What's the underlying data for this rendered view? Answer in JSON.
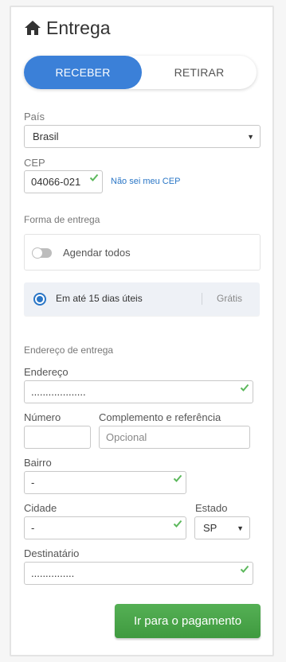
{
  "header": {
    "title": "Entrega",
    "icon": "home-icon"
  },
  "delivery_mode": {
    "options": [
      "RECEBER",
      "RETIRAR"
    ],
    "selected": "RECEBER",
    "accent": "#3b80d8"
  },
  "country": {
    "label": "País",
    "value": "Brasil"
  },
  "cep": {
    "label": "CEP",
    "value": "04066-021",
    "help_link": "Não sei meu CEP"
  },
  "delivery_form": {
    "label": "Forma de entrega",
    "schedule_all": {
      "label": "Agendar todos",
      "enabled": false
    },
    "option": {
      "text": "Em até 15 dias úteis",
      "price": "Grátis",
      "selected": true
    }
  },
  "address": {
    "section_label": "Endereço de entrega",
    "street": {
      "label": "Endereço",
      "value": "..................."
    },
    "number": {
      "label": "Número",
      "value": ""
    },
    "complement": {
      "label": "Complemento e referência",
      "placeholder": "Opcional"
    },
    "neighborhood": {
      "label": "Bairro",
      "value": "-"
    },
    "city": {
      "label": "Cidade",
      "value": "-"
    },
    "state": {
      "label": "Estado",
      "value": "SP"
    },
    "recipient": {
      "label": "Destinatário",
      "value": "..............."
    }
  },
  "actions": {
    "submit": "Ir para o pagamento",
    "submit_color": "#4aa44a"
  },
  "colors": {
    "valid_check": "#5cb85c",
    "link": "#2a76c6"
  }
}
